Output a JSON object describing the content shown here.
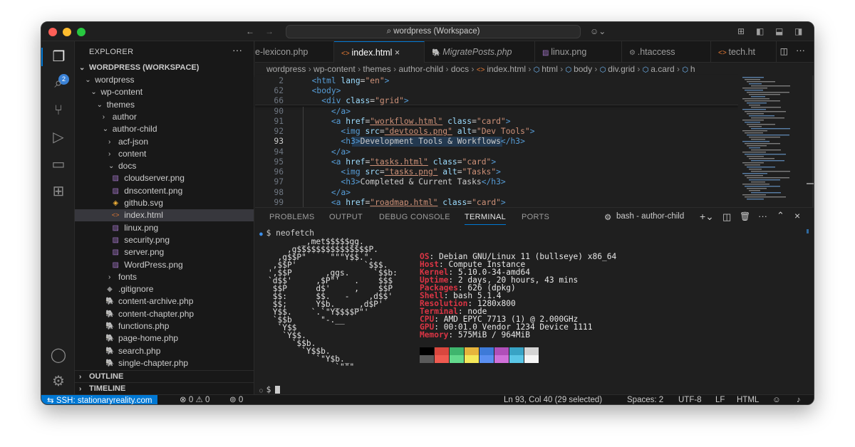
{
  "window": {
    "search_label": "wordpress (Workspace)"
  },
  "activity_badge": "2",
  "explorer": {
    "header": "EXPLORER",
    "workspace": "WORDPRESS (WORKSPACE)",
    "tree": [
      {
        "label": "wordpress",
        "type": "folder-open",
        "depth": 1
      },
      {
        "label": "wp-content",
        "type": "folder-open",
        "depth": 2
      },
      {
        "label": "themes",
        "type": "folder-open",
        "depth": 3
      },
      {
        "label": "author",
        "type": "folder-closed",
        "depth": 4
      },
      {
        "label": "author-child",
        "type": "folder-open",
        "depth": 4
      },
      {
        "label": "acf-json",
        "type": "folder-closed",
        "depth": 5
      },
      {
        "label": "content",
        "type": "folder-closed",
        "depth": 5
      },
      {
        "label": "docs",
        "type": "folder-open",
        "depth": 5
      },
      {
        "label": "cloudserver.png",
        "type": "image",
        "depth": 6
      },
      {
        "label": "dnscontent.png",
        "type": "image",
        "depth": 6
      },
      {
        "label": "github.svg",
        "type": "svg",
        "depth": 6
      },
      {
        "label": "index.html",
        "type": "html",
        "depth": 6,
        "selected": true
      },
      {
        "label": "linux.png",
        "type": "image",
        "depth": 6
      },
      {
        "label": "security.png",
        "type": "image",
        "depth": 6
      },
      {
        "label": "server.png",
        "type": "image",
        "depth": 6
      },
      {
        "label": "WordPress.png",
        "type": "image",
        "depth": 6
      },
      {
        "label": "fonts",
        "type": "folder-closed",
        "depth": 5
      },
      {
        "label": ".gitignore",
        "type": "git",
        "depth": 5
      },
      {
        "label": "content-archive.php",
        "type": "php",
        "depth": 5
      },
      {
        "label": "content-chapter.php",
        "type": "php",
        "depth": 5
      },
      {
        "label": "functions.php",
        "type": "php",
        "depth": 5
      },
      {
        "label": "page-home.php",
        "type": "php",
        "depth": 5
      },
      {
        "label": "search.php",
        "type": "php",
        "depth": 5
      },
      {
        "label": "single-chapter.php",
        "type": "php",
        "depth": 5
      }
    ],
    "outline": "OUTLINE",
    "timeline": "TIMELINE"
  },
  "tabs": [
    {
      "label": "e-lexicon.php",
      "icon": "php",
      "active": false
    },
    {
      "label": "index.html",
      "icon": "html",
      "active": true
    },
    {
      "label": "MigratePosts.php",
      "icon": "php",
      "active": false
    },
    {
      "label": "linux.png",
      "icon": "image",
      "active": false
    },
    {
      "label": ".htaccess",
      "icon": "gear",
      "active": false
    },
    {
      "label": "tech.ht",
      "icon": "html",
      "active": false
    }
  ],
  "breadcrumbs": [
    "wordpress",
    "wp-content",
    "themes",
    "author-child",
    "docs",
    "index.html",
    "html",
    "body",
    "div.grid",
    "a.card",
    "h"
  ],
  "editor": {
    "lines": [
      {
        "n": "2",
        "parts": [
          [
            "  ",
            ""
          ],
          [
            "<html ",
            "t"
          ],
          [
            "lang",
            "a"
          ],
          [
            "=",
            ""
          ],
          [
            "\"en\"",
            "s"
          ],
          [
            ">",
            "t"
          ]
        ]
      },
      {
        "n": "62",
        "parts": [
          [
            "  ",
            ""
          ],
          [
            "<body>",
            "t"
          ]
        ]
      },
      {
        "n": "66",
        "parts": [
          [
            "    ",
            ""
          ],
          [
            "<div ",
            "t"
          ],
          [
            "class",
            "a"
          ],
          [
            "=",
            ""
          ],
          [
            "\"grid\"",
            "s"
          ],
          [
            ">",
            "t"
          ]
        ]
      },
      {
        "n": "90",
        "parts": [
          [
            "      ",
            ""
          ],
          [
            "</a>",
            "t"
          ]
        ]
      },
      {
        "n": "91",
        "parts": [
          [
            "      ",
            ""
          ],
          [
            "<a ",
            "t"
          ],
          [
            "href",
            "a"
          ],
          [
            "=",
            ""
          ],
          [
            "\"workflow.html\"",
            "su"
          ],
          [
            " ",
            ""
          ],
          [
            "class",
            "a"
          ],
          [
            "=",
            ""
          ],
          [
            "\"card\"",
            "s"
          ],
          [
            ">",
            "t"
          ]
        ]
      },
      {
        "n": "92",
        "parts": [
          [
            "        ",
            ""
          ],
          [
            "<img ",
            "t"
          ],
          [
            "src",
            "a"
          ],
          [
            "=",
            ""
          ],
          [
            "\"devtools.png\"",
            "su"
          ],
          [
            " ",
            ""
          ],
          [
            "alt",
            "a"
          ],
          [
            "=",
            ""
          ],
          [
            "\"Dev Tools\"",
            "s"
          ],
          [
            ">",
            "t"
          ]
        ]
      },
      {
        "n": "93",
        "parts": [
          [
            "        ",
            ""
          ],
          [
            "<h3>",
            "t"
          ],
          [
            "Development Tools & Workflows",
            ""
          ],
          [
            "</h3>",
            "t"
          ]
        ]
      },
      {
        "n": "94",
        "parts": [
          [
            "      ",
            ""
          ],
          [
            "</a>",
            "t"
          ]
        ]
      },
      {
        "n": "95",
        "parts": [
          [
            "      ",
            ""
          ],
          [
            "<a ",
            "t"
          ],
          [
            "href",
            "a"
          ],
          [
            "=",
            ""
          ],
          [
            "\"tasks.html\"",
            "su"
          ],
          [
            " ",
            ""
          ],
          [
            "class",
            "a"
          ],
          [
            "=",
            ""
          ],
          [
            "\"card\"",
            "s"
          ],
          [
            ">",
            "t"
          ]
        ]
      },
      {
        "n": "96",
        "parts": [
          [
            "        ",
            ""
          ],
          [
            "<img ",
            "t"
          ],
          [
            "src",
            "a"
          ],
          [
            "=",
            ""
          ],
          [
            "\"tasks.png\"",
            "su"
          ],
          [
            " ",
            ""
          ],
          [
            "alt",
            "a"
          ],
          [
            "=",
            ""
          ],
          [
            "\"Tasks\"",
            "s"
          ],
          [
            ">",
            "t"
          ]
        ]
      },
      {
        "n": "97",
        "parts": [
          [
            "        ",
            ""
          ],
          [
            "<h3>",
            "t"
          ],
          [
            "Completed & Current Tasks",
            ""
          ],
          [
            "</h3>",
            "t"
          ]
        ]
      },
      {
        "n": "98",
        "parts": [
          [
            "      ",
            ""
          ],
          [
            "</a>",
            "t"
          ]
        ]
      },
      {
        "n": "99",
        "parts": [
          [
            "      ",
            ""
          ],
          [
            "<a ",
            "t"
          ],
          [
            "href",
            "a"
          ],
          [
            "=",
            ""
          ],
          [
            "\"roadmap.html\"",
            "su"
          ],
          [
            " ",
            ""
          ],
          [
            "class",
            "a"
          ],
          [
            "=",
            ""
          ],
          [
            "\"card\"",
            "s"
          ],
          [
            ">",
            "t"
          ]
        ]
      }
    ]
  },
  "panel": {
    "tabs": [
      "PROBLEMS",
      "OUTPUT",
      "DEBUG CONSOLE",
      "TERMINAL",
      "PORTS"
    ],
    "active_tab": "TERMINAL",
    "shell_label": "bash - author-child"
  },
  "terminal": {
    "command": "neofetch",
    "prompt": "$",
    "logo": [
      "       _,met$$$$$gg.",
      "    ,g$$$$$$$$$$$$$$$P.",
      "  ,g$$P\"     \"\"\"Y$$.\".",
      " ,$$P'              `$$$.",
      "',$$P       ,ggs.     `$$b:",
      "`d$$'     ,$P\"'   .    $$$",
      " $$P      d$'     ,    $$P",
      " $$:      $$.   -    ,d$$'",
      " $$;      Y$b._   _,d$P'",
      " Y$$.    `.`\"Y$$$$P\"'",
      " `$$b      \"-.__",
      "  `Y$$",
      "   `Y$$.",
      "     `$$b.",
      "       `Y$$b.",
      "          `\"Y$b._",
      "              `\"\"\""
    ],
    "info": [
      {
        "key": "OS",
        "value": "Debian GNU/Linux 11 (bullseye) x86_64"
      },
      {
        "key": "Host",
        "value": "Compute Instance"
      },
      {
        "key": "Kernel",
        "value": "5.10.0-34-amd64"
      },
      {
        "key": "Uptime",
        "value": "2 days, 20 hours, 43 mins"
      },
      {
        "key": "Packages",
        "value": "626 (dpkg)"
      },
      {
        "key": "Shell",
        "value": "bash 5.1.4"
      },
      {
        "key": "Resolution",
        "value": "1280x800"
      },
      {
        "key": "Terminal",
        "value": "node"
      },
      {
        "key": "CPU",
        "value": "AMD EPYC 7713 (1) @ 2.000GHz"
      },
      {
        "key": "GPU",
        "value": "00:01.0 Vendor 1234 Device 1111"
      },
      {
        "key": "Memory",
        "value": "575MiB / 964MiB"
      }
    ],
    "palette_top": [
      "#000000",
      "#d9473e",
      "#3fb56d",
      "#e6b43c",
      "#3d7ad8",
      "#b04fb9",
      "#38a3c5",
      "#d4d4d4"
    ],
    "palette_bottom": [
      "#5a5a5a",
      "#ef5a50",
      "#63d98c",
      "#f4e85a",
      "#5a8ff0",
      "#d070d9",
      "#5ac6e6",
      "#f5f5f5"
    ]
  },
  "statusbar": {
    "ssh": "SSH: stationaryreality.com",
    "errors": "0",
    "warnings": "0",
    "ports": "0",
    "position": "Ln 93, Col 40 (29 selected)",
    "spaces": "Spaces: 2",
    "encoding": "UTF-8",
    "eol": "LF",
    "language": "HTML"
  }
}
